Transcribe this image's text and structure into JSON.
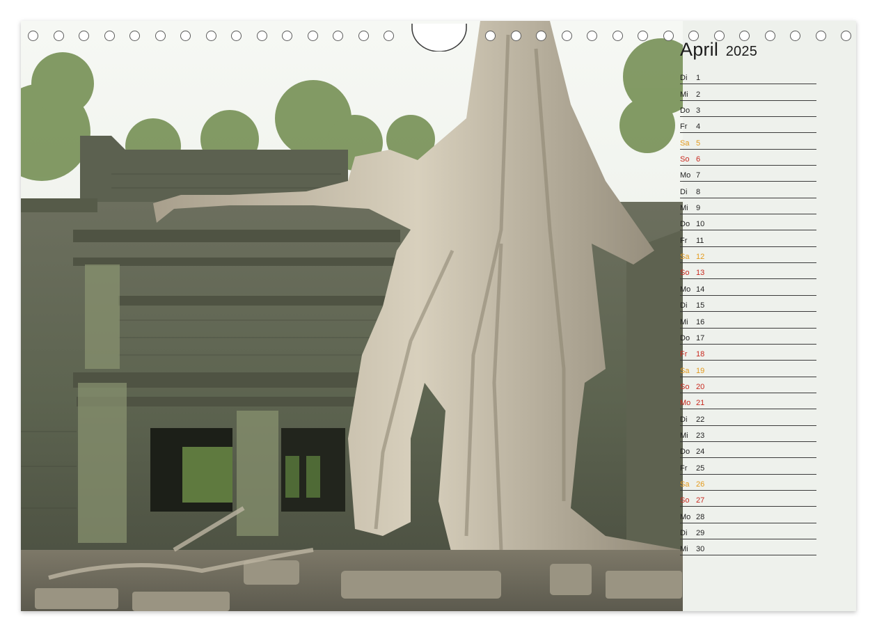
{
  "calendar": {
    "month": "April",
    "year": "2025",
    "days": [
      {
        "wd": "Di",
        "d": "1",
        "type": "weekday"
      },
      {
        "wd": "Mi",
        "d": "2",
        "type": "weekday"
      },
      {
        "wd": "Do",
        "d": "3",
        "type": "weekday"
      },
      {
        "wd": "Fr",
        "d": "4",
        "type": "weekday"
      },
      {
        "wd": "Sa",
        "d": "5",
        "type": "sat"
      },
      {
        "wd": "So",
        "d": "6",
        "type": "sun"
      },
      {
        "wd": "Mo",
        "d": "7",
        "type": "weekday"
      },
      {
        "wd": "Di",
        "d": "8",
        "type": "weekday"
      },
      {
        "wd": "Mi",
        "d": "9",
        "type": "weekday"
      },
      {
        "wd": "Do",
        "d": "10",
        "type": "weekday"
      },
      {
        "wd": "Fr",
        "d": "11",
        "type": "weekday"
      },
      {
        "wd": "Sa",
        "d": "12",
        "type": "sat"
      },
      {
        "wd": "So",
        "d": "13",
        "type": "sun"
      },
      {
        "wd": "Mo",
        "d": "14",
        "type": "weekday"
      },
      {
        "wd": "Di",
        "d": "15",
        "type": "weekday"
      },
      {
        "wd": "Mi",
        "d": "16",
        "type": "weekday"
      },
      {
        "wd": "Do",
        "d": "17",
        "type": "weekday"
      },
      {
        "wd": "Fr",
        "d": "18",
        "type": "hol"
      },
      {
        "wd": "Sa",
        "d": "19",
        "type": "sat"
      },
      {
        "wd": "So",
        "d": "20",
        "type": "sun"
      },
      {
        "wd": "Mo",
        "d": "21",
        "type": "hol"
      },
      {
        "wd": "Di",
        "d": "22",
        "type": "weekday"
      },
      {
        "wd": "Mi",
        "d": "23",
        "type": "weekday"
      },
      {
        "wd": "Do",
        "d": "24",
        "type": "weekday"
      },
      {
        "wd": "Fr",
        "d": "25",
        "type": "weekday"
      },
      {
        "wd": "Sa",
        "d": "26",
        "type": "sat"
      },
      {
        "wd": "So",
        "d": "27",
        "type": "sun"
      },
      {
        "wd": "Mo",
        "d": "28",
        "type": "weekday"
      },
      {
        "wd": "Di",
        "d": "29",
        "type": "weekday"
      },
      {
        "wd": "Mi",
        "d": "30",
        "type": "weekday"
      }
    ]
  },
  "photo": {
    "subject": "temple-ruin-with-tree-roots-icon"
  },
  "colors": {
    "saturday": "#e39a1c",
    "sunday_holiday": "#c8281e",
    "panel": "#eef1ec"
  }
}
